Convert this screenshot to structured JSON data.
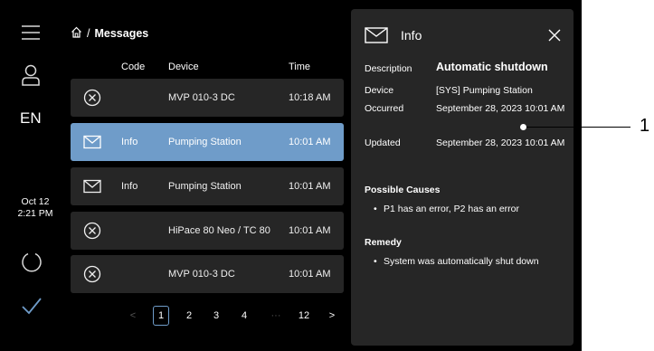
{
  "breadcrumb": {
    "current": "Messages",
    "separator": "/"
  },
  "sidebar": {
    "language": "EN",
    "date": "Oct 12",
    "time": "2:21 PM"
  },
  "table": {
    "columns": {
      "code": "Code",
      "device": "Device",
      "time": "Time"
    },
    "rows": [
      {
        "icon": "error-circle-icon",
        "code": "",
        "device": "MVP 010-3 DC",
        "time": "10:18 AM",
        "selected": false
      },
      {
        "icon": "envelope-icon",
        "code": "Info",
        "device": "Pumping Station",
        "time": "10:01 AM",
        "selected": true
      },
      {
        "icon": "envelope-icon",
        "code": "Info",
        "device": "Pumping Station",
        "time": "10:01 AM",
        "selected": false
      },
      {
        "icon": "error-circle-icon",
        "code": "",
        "device": "HiPace 80 Neo / TC 80",
        "time": "10:01 AM",
        "selected": false
      },
      {
        "icon": "error-circle-icon",
        "code": "",
        "device": "MVP 010-3 DC",
        "time": "10:01 AM",
        "selected": false
      }
    ]
  },
  "pagination": {
    "prev": "<",
    "pages": [
      "1",
      "2",
      "3",
      "4"
    ],
    "ellipsis": "···",
    "last": "12",
    "next": ">",
    "current": "1"
  },
  "panel": {
    "title": "Info",
    "description_label": "Description",
    "description": "Automatic shutdown",
    "device_label": "Device",
    "device": "[SYS] Pumping Station",
    "occurred_label": "Occurred",
    "occurred": "September 28, 2023 10:01 AM",
    "updated_label": "Updated",
    "updated": "September 28, 2023 10:01 AM",
    "causes_title": "Possible Causes",
    "causes": [
      "P1 has an error, P2 has an error"
    ],
    "remedy_title": "Remedy",
    "remedy": [
      "System was automatically shut down"
    ]
  },
  "callout": {
    "label": "1"
  },
  "colors": {
    "accent": "#6f9cc9",
    "row_bg": "#262626",
    "panel_bg": "#262626",
    "background": "#000000"
  }
}
